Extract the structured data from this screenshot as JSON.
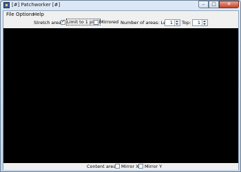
{
  "window": {
    "title": "[#] Patchworker [#]",
    "minimize_glyph": "–",
    "maximize_glyph": "□",
    "close_glyph": "✕"
  },
  "menu": {
    "file": "File",
    "options": "Options",
    "help": "Help"
  },
  "toolbar": {
    "stretch_label": "Stretch areas:",
    "limit_label": "Limit to 1 pixel",
    "limit_checked": true,
    "mirrored_label": "Mirrored",
    "mirrored_checked": false,
    "num_areas_label": "Number of areas: Left:",
    "left_value": "1",
    "top_label": "Top:",
    "top_value": "1"
  },
  "bottom": {
    "content_label": "Content areas:",
    "mirror_x_label": "Mirror X",
    "mirror_x_checked": false,
    "mirror_y_label": "Mirror Y",
    "mirror_y_checked": false
  }
}
